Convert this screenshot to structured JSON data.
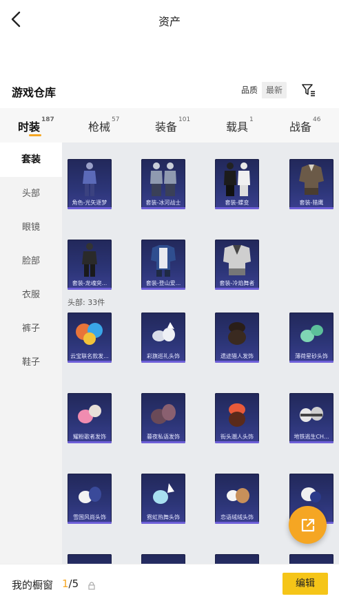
{
  "header": {
    "title": "资产"
  },
  "warehouse": {
    "title": "游戏仓库",
    "sort_options": [
      "品质",
      "最新"
    ]
  },
  "tabs": [
    {
      "label": "时装",
      "count": "187"
    },
    {
      "label": "枪械",
      "count": "57"
    },
    {
      "label": "装备",
      "count": "101"
    },
    {
      "label": "载具",
      "count": "1"
    },
    {
      "label": "战备",
      "count": "46"
    }
  ],
  "side_nav": [
    "套装",
    "头部",
    "眼镜",
    "脸部",
    "衣服",
    "裤子",
    "鞋子"
  ],
  "outfits": [
    "角色-光矢逐梦",
    "套装-冰河战士",
    "套装-蝶变",
    "套装-猎鹰",
    "套装-龙魂突...",
    "套装-登山爱...",
    "套装-冷焰舞者"
  ],
  "head_section": {
    "label": "头部: 33件"
  },
  "heads": [
    "云宝联名款发...",
    "彩旗巡礼头饰",
    "遗迹猎人发饰",
    "薄荷星砂头饰",
    "耀粉歌者发饰",
    "暮夜私语发饰",
    "街头潮人头饰",
    "地铁逃生CH...",
    "雪国风尚头饰",
    "霓虹热舞头饰",
    "恋语绒绒头饰",
    ""
  ],
  "bottom": {
    "showcase_label": "我的橱窗",
    "showcase_current": "1",
    "showcase_total": "/5",
    "edit_label": "编辑"
  },
  "colors": {
    "accent": "#f5a623",
    "edit_button": "#f5c518",
    "card_bg": "#2c3577"
  }
}
